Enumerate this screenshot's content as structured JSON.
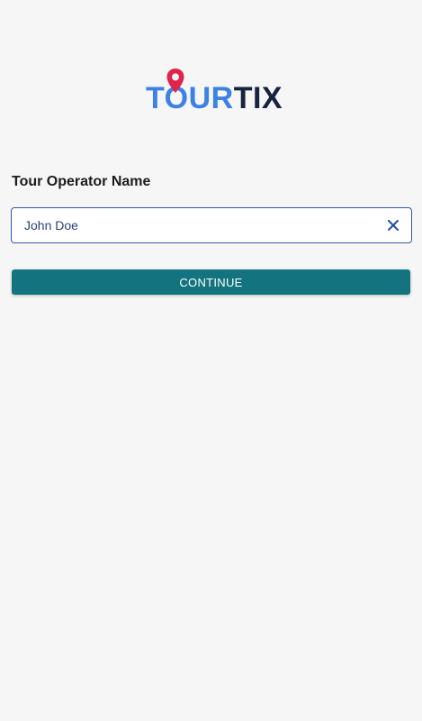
{
  "logo": {
    "part1": "TOUR",
    "part2": "TIX",
    "icon": "map-pin-icon",
    "colors": {
      "part1": "#3c82e6",
      "part2": "#17233f",
      "pin": "#e0244a"
    }
  },
  "form": {
    "label": "Tour Operator Name",
    "input_value": "John Doe",
    "clear_icon": "close-icon",
    "accent": "#3556a8"
  },
  "actions": {
    "continue_label": "CONTINUE",
    "continue_color": "#137480"
  }
}
